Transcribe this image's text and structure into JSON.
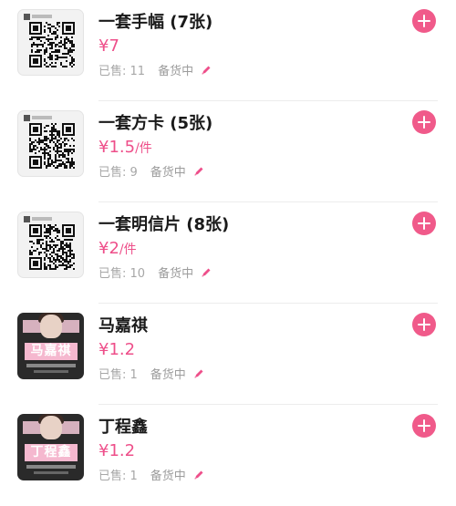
{
  "colors": {
    "accent": "#f05a8a",
    "price": "#ee4f8a"
  },
  "items": [
    {
      "title": "一套手幅 (7张)",
      "price": "¥7",
      "unit": "",
      "sold": "已售: 11",
      "status": "备货中",
      "thumb": "qr"
    },
    {
      "title": "一套方卡 (5张)",
      "price": "¥1.5",
      "unit": "/件",
      "sold": "已售: 9",
      "status": "备货中",
      "thumb": "qr"
    },
    {
      "title": "一套明信片 (8张)",
      "price": "¥2",
      "unit": "/件",
      "sold": "已售: 10",
      "status": "备货中",
      "thumb": "qr"
    },
    {
      "title": "马嘉祺",
      "price": "¥1.2",
      "unit": "",
      "sold": "已售: 1",
      "status": "备货中",
      "thumb": "photo",
      "thumb_text": "马嘉祺"
    },
    {
      "title": "丁程鑫",
      "price": "¥1.2",
      "unit": "",
      "sold": "已售: 1",
      "status": "备货中",
      "thumb": "photo",
      "thumb_text": "丁程鑫"
    }
  ],
  "icons": {
    "add": "plus-icon",
    "edit": "pencil-icon"
  }
}
